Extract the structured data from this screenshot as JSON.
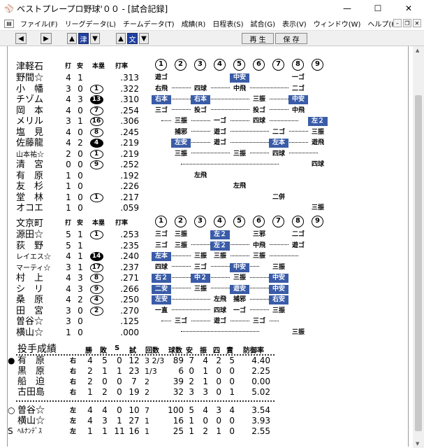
{
  "window": {
    "title": "ベストプレープロ野球'００ - [試合記録]"
  },
  "menu": [
    "ファイル(F)",
    "リーグデータ(L)",
    "チームデータ(T)",
    "成績(R)",
    "日程表(S)",
    "試合(G)",
    "表示(V)",
    "ウィンドウ(W)",
    "ヘルプ(H)"
  ],
  "toolbar": {
    "tsu": "津",
    "bun": "文",
    "replay": "再 生",
    "save": "保 存"
  },
  "batting_headers": {
    "hit": "打",
    "an": "安",
    "hr": "本塁",
    "avg": "打率"
  },
  "innings": [
    "1",
    "2",
    "3",
    "4",
    "5",
    "6",
    "7",
    "8",
    "9"
  ],
  "team1": {
    "name": "津軽石",
    "players": [
      {
        "name": "野間☆",
        "ab": "4",
        "h": "1",
        "hr": "",
        "hr_fill": false,
        "avg": ".313",
        "cells": [
          "遊ゴ",
          "",
          "",
          "",
          "中安",
          "",
          "",
          "一ゴ",
          ""
        ],
        "blue": [
          4
        ]
      },
      {
        "name": "小　幡",
        "ab": "3",
        "h": "0",
        "hr": "1",
        "hr_fill": false,
        "avg": ".322",
        "cells": [
          "右飛",
          "",
          "四球",
          "",
          "中飛",
          "",
          "",
          "二ゴ",
          ""
        ],
        "blue": []
      },
      {
        "name": "チゾム",
        "ab": "4",
        "h": "3",
        "hr": "13",
        "hr_fill": true,
        "avg": ".310",
        "cells": [
          "右本",
          "",
          "右本",
          "",
          "",
          "三振",
          "",
          "中安",
          ""
        ],
        "blue": [
          0,
          2,
          7
        ]
      },
      {
        "name": "岡　本",
        "ab": "4",
        "h": "0",
        "hr": "7",
        "hr_fill": false,
        "avg": ".254",
        "cells": [
          "三ゴ",
          "",
          "投ゴ",
          "",
          "",
          "投ゴ",
          "",
          "中飛",
          ""
        ],
        "blue": []
      },
      {
        "name": "メリル",
        "ab": "3",
        "h": "1",
        "hr": "16",
        "hr_fill": false,
        "avg": ".306",
        "cells": [
          "",
          "三振",
          "",
          "一ゴ",
          "",
          "四球",
          "",
          "",
          "左２"
        ],
        "blue": [
          8
        ]
      },
      {
        "name": "塩　見",
        "ab": "4",
        "h": "0",
        "hr": "8",
        "hr_fill": false,
        "avg": ".245",
        "cells": [
          "",
          "捕邪",
          "",
          "遊ゴ",
          "",
          "",
          "二ゴ",
          "",
          "三振"
        ],
        "blue": []
      },
      {
        "name": "佐藤龍",
        "ab": "4",
        "h": "2",
        "hr": "4",
        "hr_fill": true,
        "avg": ".219",
        "cells": [
          "",
          "左安",
          "",
          "遊ゴ",
          "",
          "",
          "左本",
          "",
          "遊飛"
        ],
        "blue": [
          1,
          6
        ]
      },
      {
        "name": "山本祐☆",
        "ab": "2",
        "h": "0",
        "hr": "1",
        "hr_fill": false,
        "avg": ".219",
        "cells": [
          "",
          "三振",
          "",
          "",
          "三振",
          "",
          "四球",
          "",
          ""
        ],
        "blue": [],
        "small": true
      },
      {
        "name": "清　宮",
        "ab": "0",
        "h": "0",
        "hr": "9",
        "hr_fill": false,
        "avg": ".252",
        "cells": [
          "",
          "",
          "",
          "",
          "",
          "",
          "",
          "",
          "四球"
        ],
        "blue": []
      },
      {
        "name": "有　原",
        "ab": "1",
        "h": "0",
        "hr": "",
        "hr_fill": false,
        "avg": ".192",
        "cells": [
          "",
          "",
          "左飛",
          "",
          "",
          "",
          "",
          "",
          ""
        ],
        "blue": []
      },
      {
        "name": "友　杉",
        "ab": "1",
        "h": "0",
        "hr": "",
        "hr_fill": false,
        "avg": ".226",
        "cells": [
          "",
          "",
          "",
          "",
          "左飛",
          "",
          "",
          "",
          ""
        ],
        "blue": []
      },
      {
        "name": "堂　林",
        "ab": "1",
        "h": "0",
        "hr": "1",
        "hr_fill": false,
        "avg": ".217",
        "cells": [
          "",
          "",
          "",
          "",
          "",
          "",
          "二併",
          "",
          ""
        ],
        "blue": []
      },
      {
        "name": "オコエ",
        "ab": "1",
        "h": "0",
        "hr": "",
        "hr_fill": false,
        "avg": ".059",
        "cells": [
          "",
          "",
          "",
          "",
          "",
          "",
          "",
          "",
          "三振"
        ],
        "blue": []
      }
    ]
  },
  "team2": {
    "name": "文京町",
    "players": [
      {
        "name": "源田☆",
        "ab": "5",
        "h": "1",
        "hr": "1",
        "hr_fill": false,
        "avg": ".253",
        "cells": [
          "三ゴ",
          "三振",
          "",
          "左２",
          "",
          "三邪",
          "",
          "二ゴ",
          ""
        ],
        "blue": [
          3
        ]
      },
      {
        "name": "荻　野",
        "ab": "5",
        "h": "1",
        "hr": "",
        "hr_fill": false,
        "avg": ".235",
        "cells": [
          "三ゴ",
          "三振",
          "",
          "左２",
          "",
          "中飛",
          "",
          "遊ゴ",
          ""
        ],
        "blue": [
          3
        ]
      },
      {
        "name": "レイエス☆",
        "ab": "4",
        "h": "1",
        "hr": "14",
        "hr_fill": true,
        "avg": ".240",
        "cells": [
          "左本",
          "",
          "三振",
          "三振",
          "",
          "三振",
          "",
          "",
          ""
        ],
        "blue": [
          0
        ],
        "small": true
      },
      {
        "name": "マーティ☆",
        "ab": "3",
        "h": "1",
        "hr": "17",
        "hr_fill": false,
        "avg": ".237",
        "cells": [
          "四球",
          "",
          "三ゴ",
          "",
          "中安",
          "",
          "三振",
          "",
          ""
        ],
        "blue": [
          4
        ],
        "small": true
      },
      {
        "name": "村　上",
        "ab": "4",
        "h": "3",
        "hr": "8",
        "hr_fill": false,
        "avg": ".271",
        "cells": [
          "右２",
          "",
          "中２",
          "",
          "三振",
          "",
          "中安",
          "",
          ""
        ],
        "blue": [
          0,
          2,
          6
        ]
      },
      {
        "name": "シ　リ",
        "ab": "4",
        "h": "3",
        "hr": "9",
        "hr_fill": false,
        "avg": ".266",
        "cells": [
          "二安",
          "",
          "三振",
          "",
          "遊安",
          "",
          "中安",
          "",
          ""
        ],
        "blue": [
          0,
          4,
          6
        ]
      },
      {
        "name": "桑　原",
        "ab": "4",
        "h": "2",
        "hr": "4",
        "hr_fill": false,
        "avg": ".250",
        "cells": [
          "左安",
          "",
          "",
          "左飛",
          "捕邪",
          "",
          "右安",
          "",
          ""
        ],
        "blue": [
          0,
          6
        ]
      },
      {
        "name": "田　宮",
        "ab": "3",
        "h": "0",
        "hr": "2",
        "hr_fill": false,
        "avg": ".270",
        "cells": [
          "一直",
          "",
          "",
          "四球",
          "一ゴ",
          "",
          "三振",
          "",
          ""
        ],
        "blue": []
      },
      {
        "name": "曽谷☆",
        "ab": "3",
        "h": "0",
        "hr": "",
        "hr_fill": false,
        "avg": ".125",
        "cells": [
          "",
          "三ゴ",
          "",
          "遊ゴ",
          "",
          "三ゴ",
          "",
          "",
          ""
        ],
        "blue": []
      },
      {
        "name": "横山☆",
        "ab": "1",
        "h": "0",
        "hr": "",
        "hr_fill": false,
        "avg": ".000",
        "cells": [
          "",
          "",
          "",
          "",
          "",
          "",
          "",
          "三振",
          ""
        ],
        "blue": []
      }
    ]
  },
  "pitching": {
    "title": "投手成績",
    "headers": [
      "勝",
      "敗",
      "S",
      "試",
      "回数",
      "球数",
      "安",
      "振",
      "四",
      "責",
      "防御率"
    ],
    "team1": [
      {
        "mark": "●",
        "name": "有　原",
        "hand": "右",
        "w": "4",
        "l": "5",
        "s": "0",
        "g": "12",
        "ip": "3 2/3",
        "np": "89",
        "h": "7",
        "k": "4",
        "bb": "2",
        "er": "5",
        "era": "4.40"
      },
      {
        "mark": "",
        "name": "黒　原",
        "hand": "右",
        "w": "2",
        "l": "1",
        "s": "1",
        "g": "23",
        "ip": "1/3",
        "np": "6",
        "h": "0",
        "k": "1",
        "bb": "0",
        "er": "0",
        "era": "2.25"
      },
      {
        "mark": "",
        "name": "船　迫",
        "hand": "右",
        "w": "2",
        "l": "0",
        "s": "0",
        "g": "7",
        "ip": "2",
        "np": "39",
        "h": "2",
        "k": "1",
        "bb": "0",
        "er": "0",
        "era": "0.00"
      },
      {
        "mark": "",
        "name": "古田島",
        "hand": "右",
        "w": "1",
        "l": "2",
        "s": "0",
        "g": "19",
        "ip": "2",
        "np": "32",
        "h": "3",
        "k": "3",
        "bb": "0",
        "er": "1",
        "era": "5.02"
      }
    ],
    "team2": [
      {
        "mark": "○",
        "name": "曽谷☆",
        "hand": "左",
        "w": "4",
        "l": "4",
        "s": "0",
        "g": "10",
        "ip": "7",
        "np": "100",
        "h": "5",
        "k": "4",
        "bb": "3",
        "er": "4",
        "era": "3.54"
      },
      {
        "mark": "",
        "name": "横山☆",
        "hand": "左",
        "w": "4",
        "l": "3",
        "s": "1",
        "g": "27",
        "ip": "1",
        "np": "16",
        "h": "1",
        "k": "0",
        "bb": "0",
        "er": "0",
        "era": "3.93"
      },
      {
        "mark": "S",
        "name": "ﾍﾙﾅﾝﾃﾞｽ",
        "hand": "左",
        "w": "1",
        "l": "1",
        "s": "11",
        "g": "16",
        "ip": "1",
        "np": "25",
        "h": "1",
        "k": "2",
        "bb": "1",
        "er": "0",
        "era": "2.55"
      }
    ]
  }
}
